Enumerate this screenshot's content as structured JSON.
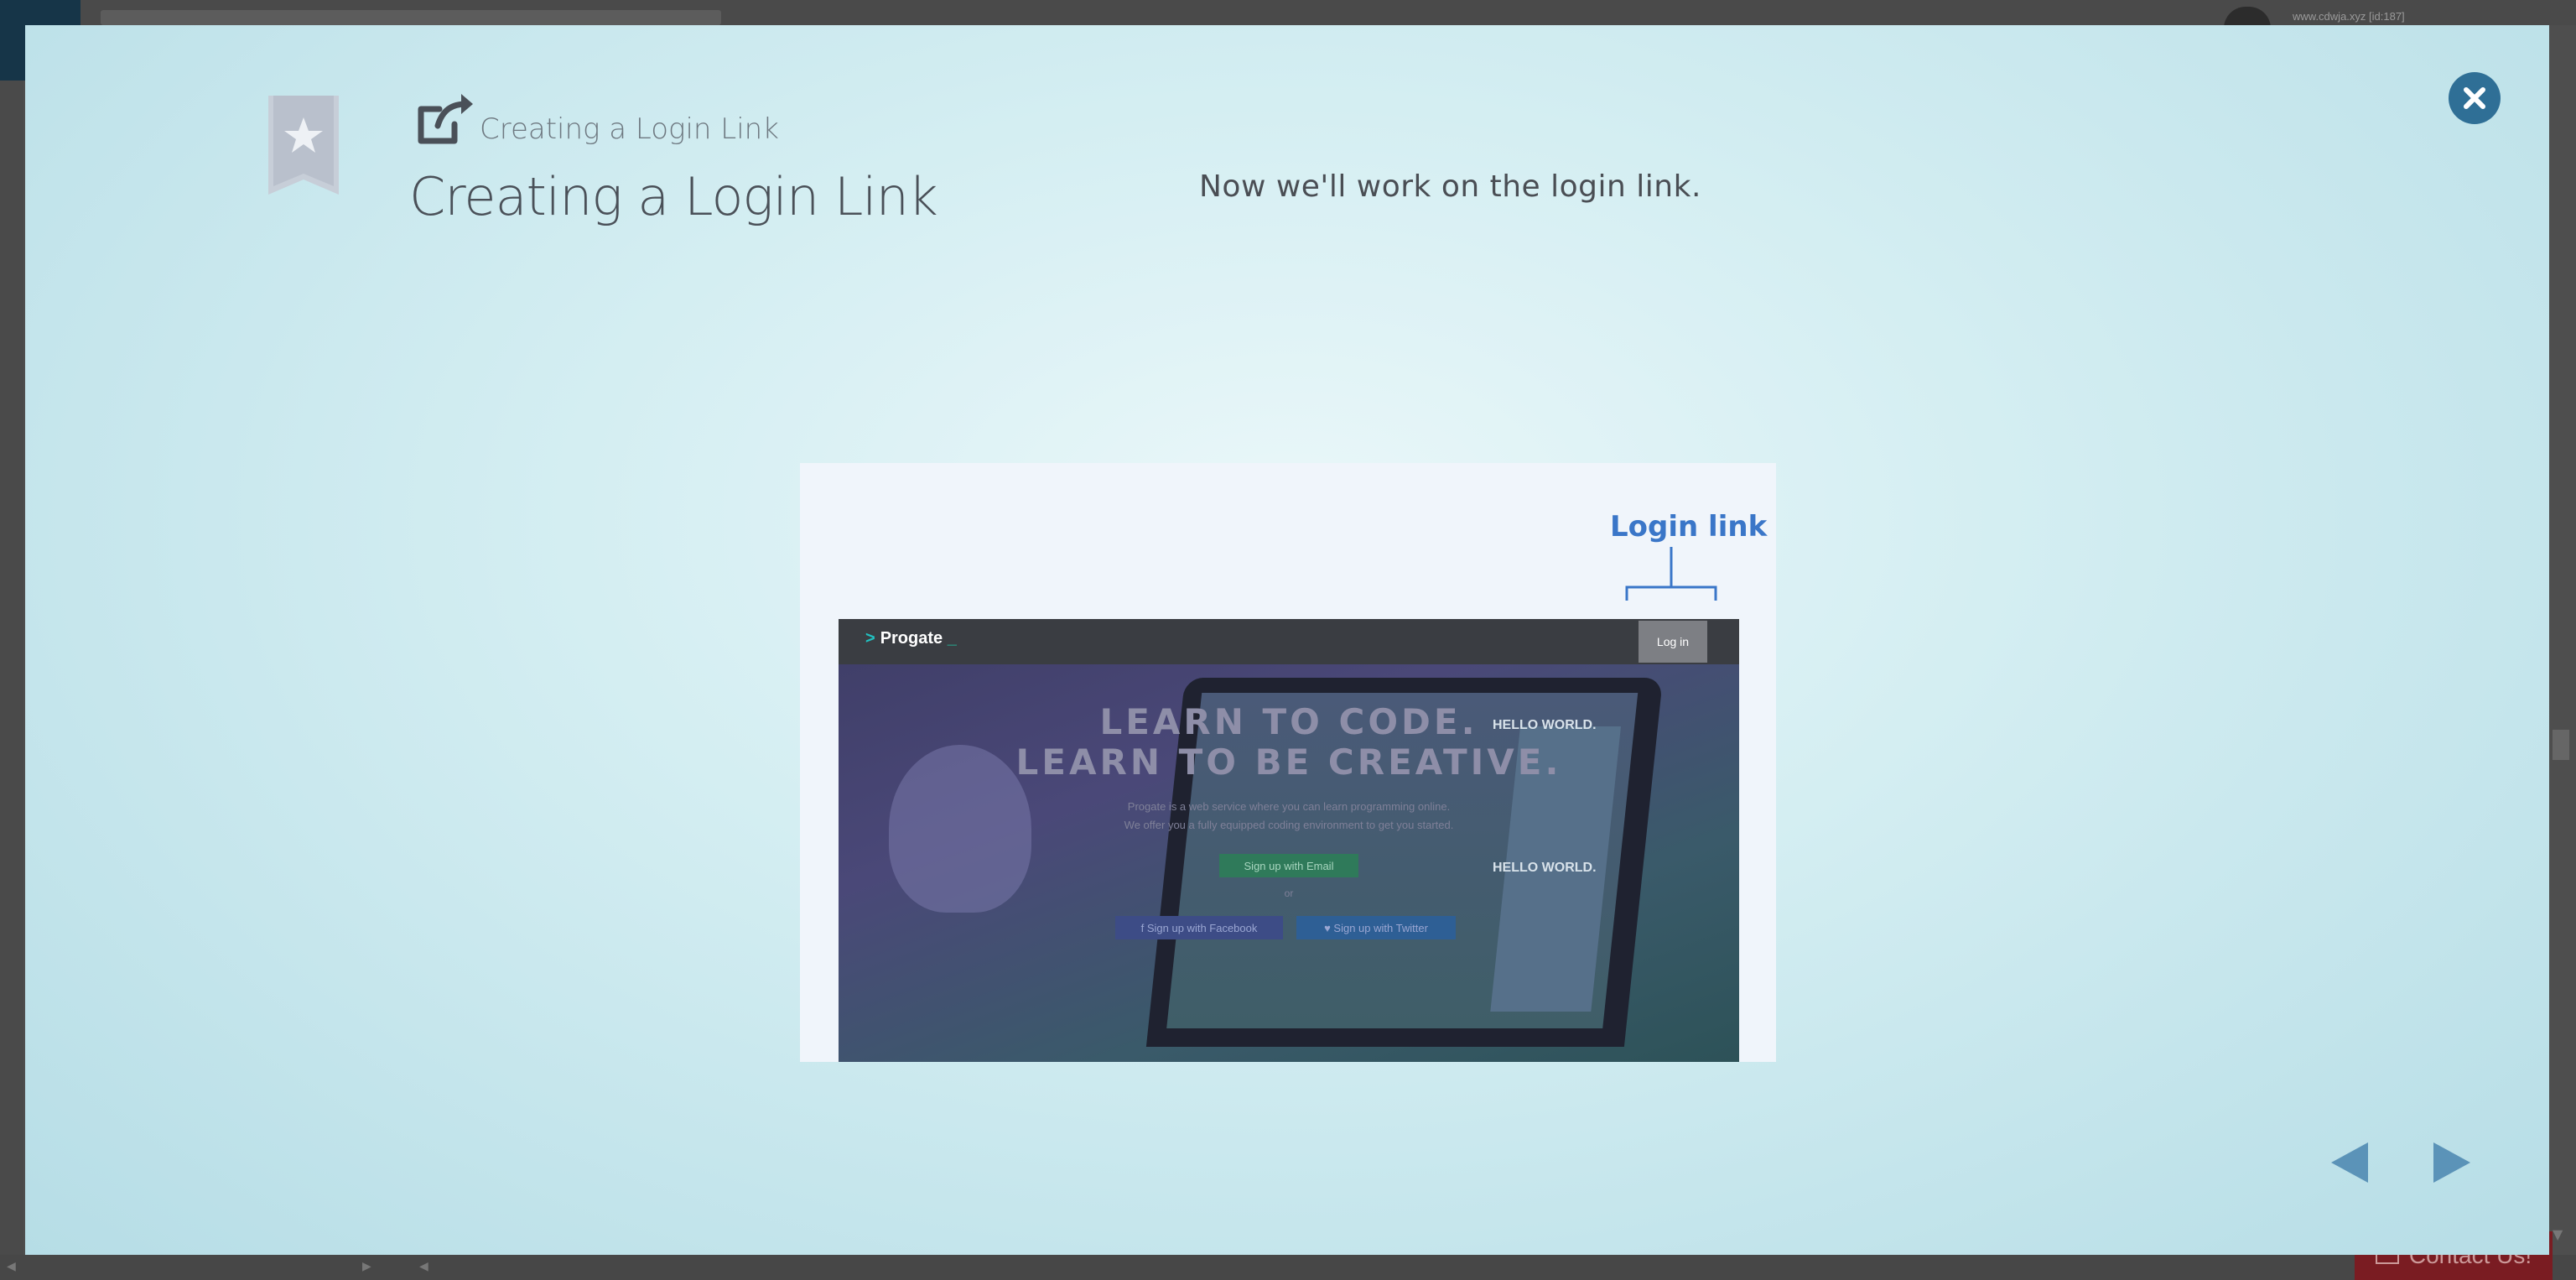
{
  "background": {
    "user_text": "www.cdwja.xyz [id:187]",
    "contact_label": "Contact Us!"
  },
  "modal": {
    "subtitle": "Creating a Login Link",
    "title": "Creating a Login Link",
    "description": "Now we'll work on the login link.",
    "icons": {
      "bookmark": "bookmark-star-icon",
      "title": "external-link-icon",
      "close": "close-icon",
      "prev": "triangle-left-icon",
      "next": "triangle-right-icon"
    },
    "colors": {
      "accent": "#2f6f96",
      "nav_arrow": "#5b93b8",
      "callout": "#3a76c8"
    }
  },
  "slide": {
    "callout_label": "Login link",
    "brand": "Progate",
    "login_button": "Log in",
    "headline_1": "LEARN TO CODE.",
    "headline_2": "LEARN TO BE CREATIVE.",
    "sub_1": "Progate is a web service where you can learn programming online.",
    "sub_2": "We offer you a fully equipped coding environment to get you started.",
    "email_button": "Sign up with Email",
    "or": "or",
    "facebook_button": "f  Sign up with Facebook",
    "twitter_button": "Sign up with Twitter",
    "mini_hello_1": "HELLO WORLD.",
    "mini_hello_2": "HELLO WORLD."
  }
}
